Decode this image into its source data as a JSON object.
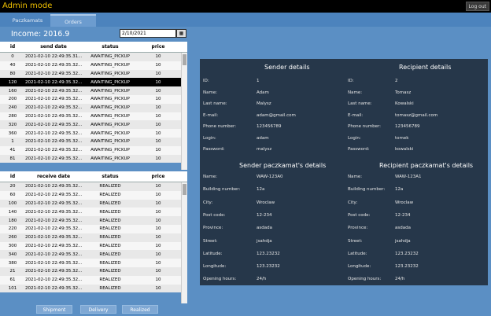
{
  "app": {
    "title": "Admin mode",
    "logout_label": "Log out"
  },
  "tabs": [
    "Paczkamats",
    "Orders"
  ],
  "income_label": "Income: 2016.9",
  "date_value": "2/10/2021",
  "calendar_icon": "calendar-icon",
  "shipments_table": {
    "headers": [
      "id",
      "send date",
      "status",
      "price"
    ],
    "rows": [
      [
        "0",
        "2021-02-10 22:49:35.31...",
        "AWAITING_PICKUP",
        "10"
      ],
      [
        "40",
        "2021-02-10 22:49:35.32...",
        "AWAITING_PICKUP",
        "10"
      ],
      [
        "80",
        "2021-02-10 22:49:35.32...",
        "AWAITING_PICKUP",
        "10"
      ],
      [
        "120",
        "2021-02-10 22:49:35.32...",
        "AWAITING_PICKUP",
        "10"
      ],
      [
        "160",
        "2021-02-10 22:49:35.32...",
        "AWAITING_PICKUP",
        "10"
      ],
      [
        "200",
        "2021-02-10 22:49:35.32...",
        "AWAITING_PICKUP",
        "10"
      ],
      [
        "240",
        "2021-02-10 22:49:35.32...",
        "AWAITING_PICKUP",
        "10"
      ],
      [
        "280",
        "2021-02-10 22:49:35.32...",
        "AWAITING_PICKUP",
        "10"
      ],
      [
        "320",
        "2021-02-10 22:49:35.32...",
        "AWAITING_PICKUP",
        "10"
      ],
      [
        "360",
        "2021-02-10 22:49:35.32...",
        "AWAITING_PICKUP",
        "10"
      ],
      [
        "1",
        "2021-02-10 22:49:35.32...",
        "AWAITING_PICKUP",
        "10"
      ],
      [
        "41",
        "2021-02-10 22:49:35.32...",
        "AWAITING_PICKUP",
        "10"
      ],
      [
        "81",
        "2021-02-10 22:49:35.32...",
        "AWAITING_PICKUP",
        "10"
      ]
    ],
    "selected_index": 3
  },
  "deliveries_table": {
    "headers": [
      "id",
      "receive date",
      "status",
      "price"
    ],
    "rows": [
      [
        "20",
        "2021-02-10 22:49:35.32...",
        "REALIZED",
        "10"
      ],
      [
        "60",
        "2021-02-10 22:49:35.32...",
        "REALIZED",
        "10"
      ],
      [
        "100",
        "2021-02-10 22:49:35.32...",
        "REALIZED",
        "10"
      ],
      [
        "140",
        "2021-02-10 22:49:35.32...",
        "REALIZED",
        "10"
      ],
      [
        "180",
        "2021-02-10 22:49:35.32...",
        "REALIZED",
        "10"
      ],
      [
        "220",
        "2021-02-10 22:49:35.32...",
        "REALIZED",
        "10"
      ],
      [
        "260",
        "2021-02-10 22:49:35.32...",
        "REALIZED",
        "10"
      ],
      [
        "300",
        "2021-02-10 22:49:35.32...",
        "REALIZED",
        "10"
      ],
      [
        "340",
        "2021-02-10 22:49:35.32...",
        "REALIZED",
        "10"
      ],
      [
        "380",
        "2021-02-10 22:49:35.32...",
        "REALIZED",
        "10"
      ],
      [
        "21",
        "2021-02-10 22:49:35.32...",
        "REALIZED",
        "10"
      ],
      [
        "61",
        "2021-02-10 22:49:35.32...",
        "REALIZED",
        "10"
      ],
      [
        "101",
        "2021-02-10 22:49:35.32...",
        "REALIZED",
        "10"
      ]
    ]
  },
  "bottom_buttons": [
    "Shipment",
    "Delivery",
    "Realized"
  ],
  "details": {
    "sender_title": "Sender details",
    "recipient_title": "Recipient details",
    "person_labels": [
      "ID:",
      "Name:",
      "Last name:",
      "E-mail:",
      "Phone number:",
      "Login:",
      "Password:"
    ],
    "sender_values": [
      "1",
      "Adam",
      "Malysz",
      "adam@gmail.com",
      "123456789",
      "adam",
      "malysz"
    ],
    "recipient_values": [
      "2",
      "Tomasz",
      "Kowalski",
      "tomasz@gmail.com",
      "123456789",
      "tomek",
      "kowalski"
    ],
    "sender_pk_title": "Sender paczkamat's details",
    "recipient_pk_title": "Recipient paczkamat's details",
    "pk_labels": [
      "Name:",
      "Building number:",
      "City:",
      "Post code:",
      "Province:",
      "Street:",
      "Latitude:",
      "Longitude:",
      "Opening hours:"
    ],
    "sender_pk_values": [
      "WAW-123A0",
      "12a",
      "Wroclaw",
      "12-234",
      "asdada",
      "jsahdja",
      "123.23232",
      "123.23232",
      "24/h"
    ],
    "recipient_pk_values": [
      "WAW-123A1",
      "12a",
      "Wroclaw",
      "12-234",
      "asdada",
      "jsahdja",
      "123.23232",
      "123.23232",
      "24/h"
    ]
  },
  "colors": {
    "background": "#5b8fc4",
    "panel": "#26374a",
    "title_accent": "#f0c000"
  }
}
